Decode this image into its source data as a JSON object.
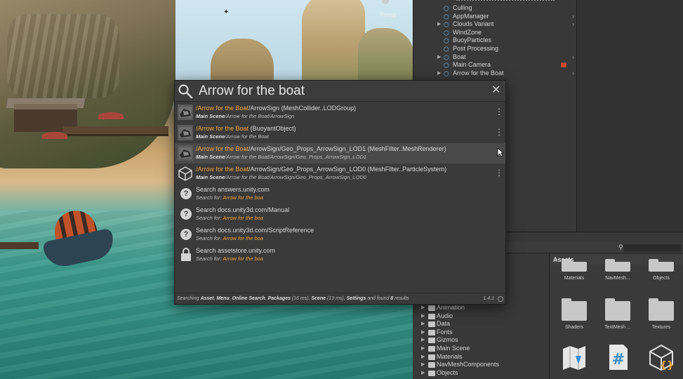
{
  "scene": {
    "view_label": "Persp"
  },
  "hierarchy": {
    "items": [
      {
        "label": "Culling",
        "has_arrow": false,
        "has_chevron": false
      },
      {
        "label": "AppManager",
        "has_arrow": false,
        "has_chevron": true
      },
      {
        "label": "Clouds Variant",
        "has_arrow": true,
        "has_chevron": true
      },
      {
        "label": "WindZone",
        "has_arrow": false,
        "has_chevron": false
      },
      {
        "label": "BuoyParticles",
        "has_arrow": false,
        "has_chevron": false
      },
      {
        "label": "Post Processing",
        "has_arrow": false,
        "has_chevron": false
      },
      {
        "label": "Boat",
        "has_arrow": true,
        "has_chevron": true
      },
      {
        "label": "Main Camera",
        "has_arrow": false,
        "has_chevron": false
      },
      {
        "label": "Arrow for the Boat",
        "has_arrow": true,
        "has_chevron": true
      }
    ]
  },
  "search": {
    "query": "Arrow for the boat",
    "results": [
      {
        "highlight": "/Arrow for the Boat",
        "rest": "/ArrowSign (MeshCollider..LODGroup)",
        "scene_label": "Main Scene",
        "path": "/Arrow for the Boat/ArrowSign",
        "thumb": "mesh-thumbnail-icon",
        "selected": false
      },
      {
        "highlight": "/Arrow for the Boat",
        "rest": " (BuoyantObject)",
        "scene_label": "Main Scene",
        "path": "/Arrow for the Boat",
        "thumb": "mesh-thumbnail-icon",
        "selected": false
      },
      {
        "highlight": "/Arrow for the Boat",
        "rest": "/ArrowSign/Geo_Props_ArrowSign_LOD1 (MeshFilter..MeshRenderer)",
        "scene_label": "Main Scene",
        "path": "/Arrow for the Boat/ArrowSign/Geo_Props_ArrowSign_LOD1",
        "thumb": "mesh-thumbnail-icon",
        "selected": true
      },
      {
        "highlight": "/Arrow for the Boat",
        "rest": "/ArrowSign/Geo_Props_ArrowSign_LOD0 (MeshFilter..ParticleSystem)",
        "scene_label": "Main Scene",
        "path": "/Arrow for the Boat/ArrowSign/Geo_Props_ArrowSign_LOD0",
        "thumb": "cube-icon",
        "selected": false
      }
    ],
    "providers": [
      {
        "title": "Search answers.unity.com",
        "prefix": "Search for: ",
        "term": "Arrow for the boa",
        "icon": "help-icon"
      },
      {
        "title": "Search docs.unity3d.com/Manual",
        "prefix": "Search for: ",
        "term": "Arrow for the boa",
        "icon": "help-icon"
      },
      {
        "title": "Search docs.unity3d.com/ScriptReference",
        "prefix": "Search for: ",
        "term": "Arrow for the boa",
        "icon": "help-icon"
      },
      {
        "title": "Search assetstore.unity.com",
        "prefix": "Search for: ",
        "term": "Arrow for the boa",
        "icon": "lock-icon"
      }
    ],
    "status": {
      "prefix": "Searching ",
      "asset": "Asset",
      "sep1": ", ",
      "menu": "Menu",
      "sep2": ", ",
      "online": "Online Search",
      "sep3": ", ",
      "packages": "Packages",
      "packages_time": " (16 ms), ",
      "scene": "Scene",
      "scene_time": " (13 ms), ",
      "settings": "Settings",
      "found_text": " and found ",
      "found_count": "8",
      "results_word": " results"
    },
    "version": "1.4.1"
  },
  "project": {
    "assets_title": "Assets",
    "tree": [
      {
        "label": "Animation"
      },
      {
        "label": "Audio"
      },
      {
        "label": "Data"
      },
      {
        "label": "Fonts"
      },
      {
        "label": "Gizmos"
      },
      {
        "label": "Main Scene"
      },
      {
        "label": "Materials"
      },
      {
        "label": "NavMeshComponents"
      },
      {
        "label": "Objects"
      }
    ],
    "assets": [
      {
        "label": "Materials",
        "type": "folder"
      },
      {
        "label": "NavMesh...",
        "type": "folder"
      },
      {
        "label": "Objects",
        "type": "folder"
      },
      {
        "label": "Shaders",
        "type": "folder"
      },
      {
        "label": "TextMesh ...",
        "type": "folder"
      },
      {
        "label": "Textures",
        "type": "folder"
      }
    ]
  },
  "colors": {
    "highlight": "#f0a23c",
    "panel_bg": "#383838",
    "popup_bg": "#3a3a3a",
    "selected_row": "#4a4a4a"
  }
}
